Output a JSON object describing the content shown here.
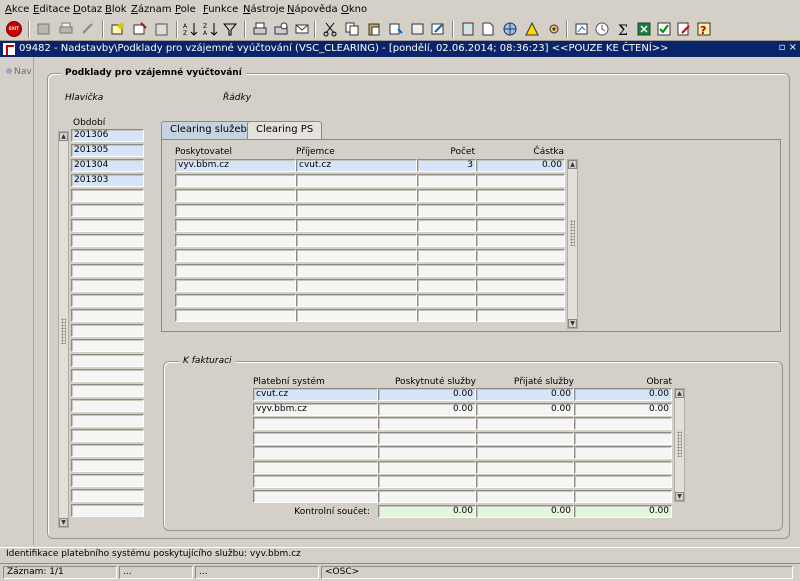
{
  "menu": [
    "Akce",
    "Editace",
    "Dotaz",
    "Blok",
    "Záznam",
    "Pole",
    "Funkce",
    "Nástroje",
    "Nápověda",
    "Okno"
  ],
  "menu_accel": [
    "A",
    "E",
    "D",
    "B",
    "Z",
    "P",
    "F",
    "N",
    "N",
    "O"
  ],
  "toolbar": {
    "exit_label": "EXIT",
    "colors": {
      "exit": "#cc0000"
    }
  },
  "window": {
    "title": "09482 - Nadstavby\\Podklady pro vzájemné vyúčtování (VSC_CLEARING) - [pondělí, 02.06.2014; 08:36:23] <<POUZE KE ČTENÍ>>",
    "controls": "▫ ×",
    "nav": "Nav"
  },
  "main": {
    "group_title": "Podklady pro vzájemné vyúčtování",
    "header_title": "Hlavička",
    "rows_title": "Řádky",
    "period": {
      "label": "Období",
      "values": [
        "201306",
        "201305",
        "201304",
        "201303",
        "",
        "",
        "",
        "",
        "",
        "",
        "",
        "",
        "",
        "",
        "",
        "",
        "",
        "",
        "",
        "",
        "",
        "",
        "",
        "",
        "",
        ""
      ]
    },
    "tabs": [
      {
        "label": "Clearing služeb",
        "active": false
      },
      {
        "label": "Clearing PS",
        "active": true
      }
    ],
    "clearing": {
      "columns": [
        "Poskytovatel",
        "Příjemce",
        "Počet",
        "Částka"
      ],
      "rows": [
        [
          "vyv.bbm.cz",
          "cvut.cz",
          "3",
          "0.00"
        ],
        [
          "",
          "",
          "",
          ""
        ],
        [
          "",
          "",
          "",
          ""
        ],
        [
          "",
          "",
          "",
          ""
        ],
        [
          "",
          "",
          "",
          ""
        ],
        [
          "",
          "",
          "",
          ""
        ],
        [
          "",
          "",
          "",
          ""
        ],
        [
          "",
          "",
          "",
          ""
        ],
        [
          "",
          "",
          "",
          ""
        ],
        [
          "",
          "",
          "",
          ""
        ],
        [
          "",
          "",
          "",
          ""
        ]
      ]
    },
    "invoicing": {
      "title": "K fakturaci",
      "columns": [
        "Platební systém",
        "Poskytnuté služby",
        "Přijaté služby",
        "Obrat"
      ],
      "rows": [
        [
          "cvut.cz",
          "0.00",
          "0.00",
          "0.00"
        ],
        [
          "vyv.bbm.cz",
          "0.00",
          "0.00",
          "0.00"
        ],
        [
          "",
          "",
          "",
          ""
        ],
        [
          "",
          "",
          "",
          ""
        ],
        [
          "",
          "",
          "",
          ""
        ],
        [
          "",
          "",
          "",
          ""
        ],
        [
          "",
          "",
          "",
          ""
        ],
        [
          "",
          "",
          "",
          ""
        ]
      ],
      "total_label": "Kontrolní součet:",
      "totals": [
        "0.00",
        "0.00",
        "0.00"
      ]
    }
  },
  "hint": "Identifikace platebního systému poskytujícího službu: vyv.bbm.cz",
  "status": {
    "record": "Záznam: 1/1",
    "dots1": "...",
    "dots2": "...",
    "mode": "<OSC>"
  }
}
